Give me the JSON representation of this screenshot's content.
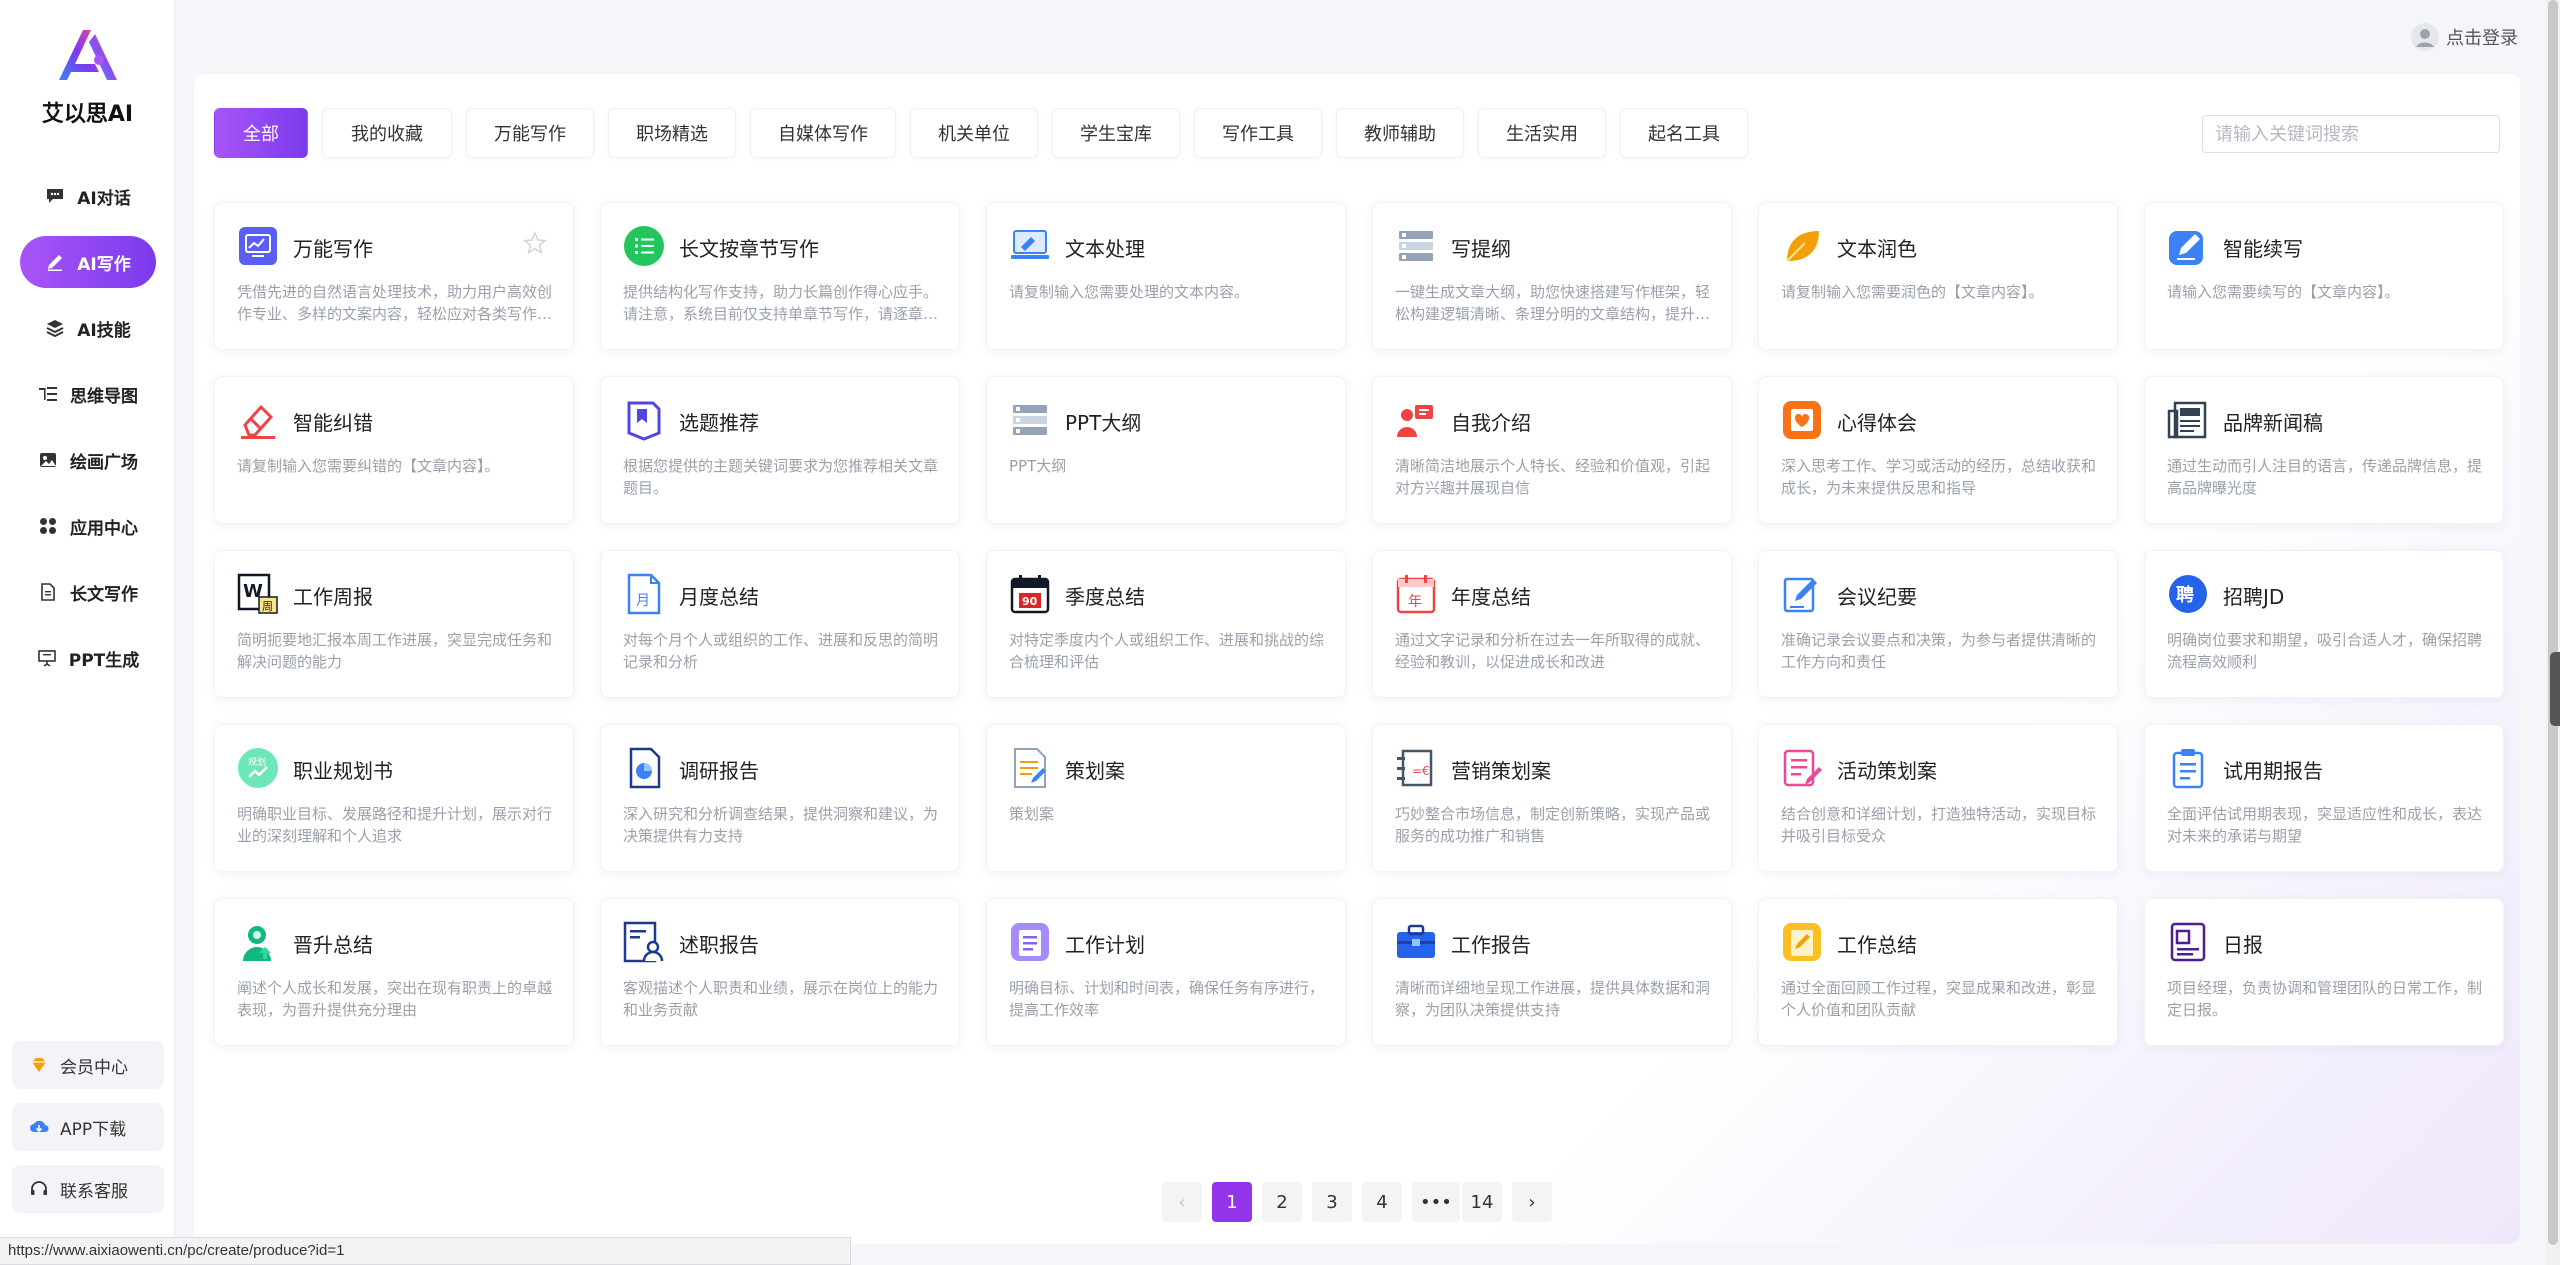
{
  "brand": {
    "name": "艾以思AI"
  },
  "login": {
    "label": "点击登录"
  },
  "nav": [
    {
      "label": "AI对话",
      "icon": "chat-icon"
    },
    {
      "label": "AI写作",
      "icon": "pen-icon",
      "active": true
    },
    {
      "label": "AI技能",
      "icon": "layers-icon"
    },
    {
      "label": "思维导图",
      "icon": "mindmap-icon"
    },
    {
      "label": "绘画广场",
      "icon": "image-icon"
    },
    {
      "label": "应用中心",
      "icon": "apps-icon"
    },
    {
      "label": "长文写作",
      "icon": "document-icon"
    },
    {
      "label": "PPT生成",
      "icon": "presentation-icon"
    }
  ],
  "side_bottom": [
    {
      "label": "会员中心",
      "icon": "diamond-icon"
    },
    {
      "label": "APP下载",
      "icon": "cloud-download-icon"
    },
    {
      "label": "联系客服",
      "icon": "headset-icon"
    }
  ],
  "tabs": [
    "全部",
    "我的收藏",
    "万能写作",
    "职场精选",
    "自媒体写作",
    "机关单位",
    "学生宝库",
    "写作工具",
    "教师辅助",
    "生活实用",
    "起名工具"
  ],
  "active_tab": 0,
  "search": {
    "placeholder": "请输入关键词搜索"
  },
  "cards": [
    {
      "title": "万能写作",
      "desc": "凭借先进的自然语言处理技术，助力用户高效创作专业、多样的文案内容，轻松应对各类写作需求",
      "icon": "monitor-chart-icon",
      "color": "#5b5ef5"
    },
    {
      "title": "长文按章节写作",
      "desc": "提供结构化写作支持，助力长篇创作得心应手。请注意，系统目前仅支持单章节写作，请逐章生成",
      "icon": "list-circle-icon",
      "color": "#22c55e"
    },
    {
      "title": "文本处理",
      "desc": "请复制输入您需要处理的文本内容。",
      "icon": "laptop-icon",
      "color": "#3b82f6"
    },
    {
      "title": "写提纲",
      "desc": "一键生成文章大纲，助您快速搭建写作框架，轻松构建逻辑清晰、条理分明的文章结构，提升写作效率",
      "icon": "outline-icon",
      "color": "#64748b"
    },
    {
      "title": "文本润色",
      "desc": "请复制输入您需要润色的【文章内容】。",
      "icon": "leaf-icon",
      "color": "#f59e0b"
    },
    {
      "title": "智能续写",
      "desc": "请输入您需要续写的【文章内容】。",
      "icon": "pen-square-icon",
      "color": "#3b82f6"
    },
    {
      "title": "智能纠错",
      "desc": "请复制输入您需要纠错的【文章内容】。",
      "icon": "eraser-icon",
      "color": "#ef4444"
    },
    {
      "title": "选题推荐",
      "desc": "根据您提供的主题关键词要求为您推荐相关文章题目。",
      "icon": "bookmark-doc-icon",
      "color": "#4f46e5"
    },
    {
      "title": "PPT大纲",
      "desc": "PPT大纲",
      "icon": "ppt-stack-icon",
      "color": "#64748b"
    },
    {
      "title": "自我介绍",
      "desc": "清晰简洁地展示个人特长、经验和价值观，引起对方兴趣并展现自信",
      "icon": "person-card-icon",
      "color": "#ef4444"
    },
    {
      "title": "心得体会",
      "desc": "深入思考工作、学习或活动的经历，总结收获和成长，为未来提供反思和指导",
      "icon": "heart-note-icon",
      "color": "#f97316"
    },
    {
      "title": "品牌新闻稿",
      "desc": "通过生动而引人注目的语言，传递品牌信息，提高品牌曝光度",
      "icon": "newspaper-icon",
      "color": "#334155"
    },
    {
      "title": "工作周报",
      "desc": "简明扼要地汇报本周工作进展，突显完成任务和解决问题的能力",
      "icon": "weekly-icon",
      "color": "#111827"
    },
    {
      "title": "月度总结",
      "desc": "对每个月个人或组织的工作、进展和反思的简明记录和分析",
      "icon": "month-doc-icon",
      "color": "#3b82f6"
    },
    {
      "title": "季度总结",
      "desc": "对特定季度内个人或组织工作、进展和挑战的综合梳理和评估",
      "icon": "calendar-90-icon",
      "color": "#111827"
    },
    {
      "title": "年度总结",
      "desc": "通过文字记录和分析在过去一年所取得的成就、经验和教训，以促进成长和改进",
      "icon": "calendar-year-icon",
      "color": "#ef4444"
    },
    {
      "title": "会议纪要",
      "desc": "准确记录会议要点和决策，为参与者提供清晰的工作方向和责任",
      "icon": "edit-doc-icon",
      "color": "#3b82f6"
    },
    {
      "title": "招聘JD",
      "desc": "明确岗位要求和期望，吸引合适人才，确保招聘流程高效顺利",
      "icon": "hire-badge-icon",
      "color": "#2563eb"
    },
    {
      "title": "职业规划书",
      "desc": "明确职业目标、发展路径和提升计划，展示对行业的深刻理解和个人追求",
      "icon": "career-icon",
      "color": "#34d399"
    },
    {
      "title": "调研报告",
      "desc": "深入研究和分析调查结果，提供洞察和建议，为决策提供有力支持",
      "icon": "survey-icon",
      "color": "#3b82f6"
    },
    {
      "title": "策划案",
      "desc": "策划案",
      "icon": "plan-doc-icon",
      "color": "#f59e0b"
    },
    {
      "title": "营销策划案",
      "desc": "巧妙整合市场信息，制定创新策略，实现产品或服务的成功推广和销售",
      "icon": "marketing-icon",
      "color": "#64748b"
    },
    {
      "title": "活动策划案",
      "desc": "结合创意和详细计划，打造独特活动，实现目标并吸引目标受众",
      "icon": "activity-icon",
      "color": "#ec4899"
    },
    {
      "title": "试用期报告",
      "desc": "全面评估试用期表现，突显适应性和成长，表达对未来的承诺与期望",
      "icon": "clipboard-icon",
      "color": "#3b82f6"
    },
    {
      "title": "晋升总结",
      "desc": "阐述个人成长和发展，突出在现有职责上的卓越表现，为晋升提供充分理由",
      "icon": "promotion-icon",
      "color": "#10b981"
    },
    {
      "title": "述职报告",
      "desc": "客观描述个人职责和业绩，展示在岗位上的能力和业务贡献",
      "icon": "report-person-icon",
      "color": "#1e3a8a"
    },
    {
      "title": "工作计划",
      "desc": "明确目标、计划和时间表，确保任务有序进行，提高工作效率",
      "icon": "plan-list-icon",
      "color": "#8b5cf6"
    },
    {
      "title": "工作报告",
      "desc": "清晰而详细地呈现工作进展，提供具体数据和洞察，为团队决策提供支持",
      "icon": "briefcase-icon",
      "color": "#2563eb"
    },
    {
      "title": "工作总结",
      "desc": "通过全面回顾工作过程，突显成果和改进，彰显个人价值和团队贡献",
      "icon": "summary-icon",
      "color": "#fbbf24"
    },
    {
      "title": "日报",
      "desc": "项目经理，负责协调和管理团队的日常工作，制定日报。",
      "icon": "daily-icon",
      "color": "#4c1d95"
    }
  ],
  "pagination": {
    "prev": "‹",
    "pages": [
      "1",
      "2",
      "3",
      "4",
      "•••",
      "14"
    ],
    "current": "1",
    "next": "›"
  },
  "status_url": "https://www.aixiaowenti.cn/pc/create/produce?id=1"
}
